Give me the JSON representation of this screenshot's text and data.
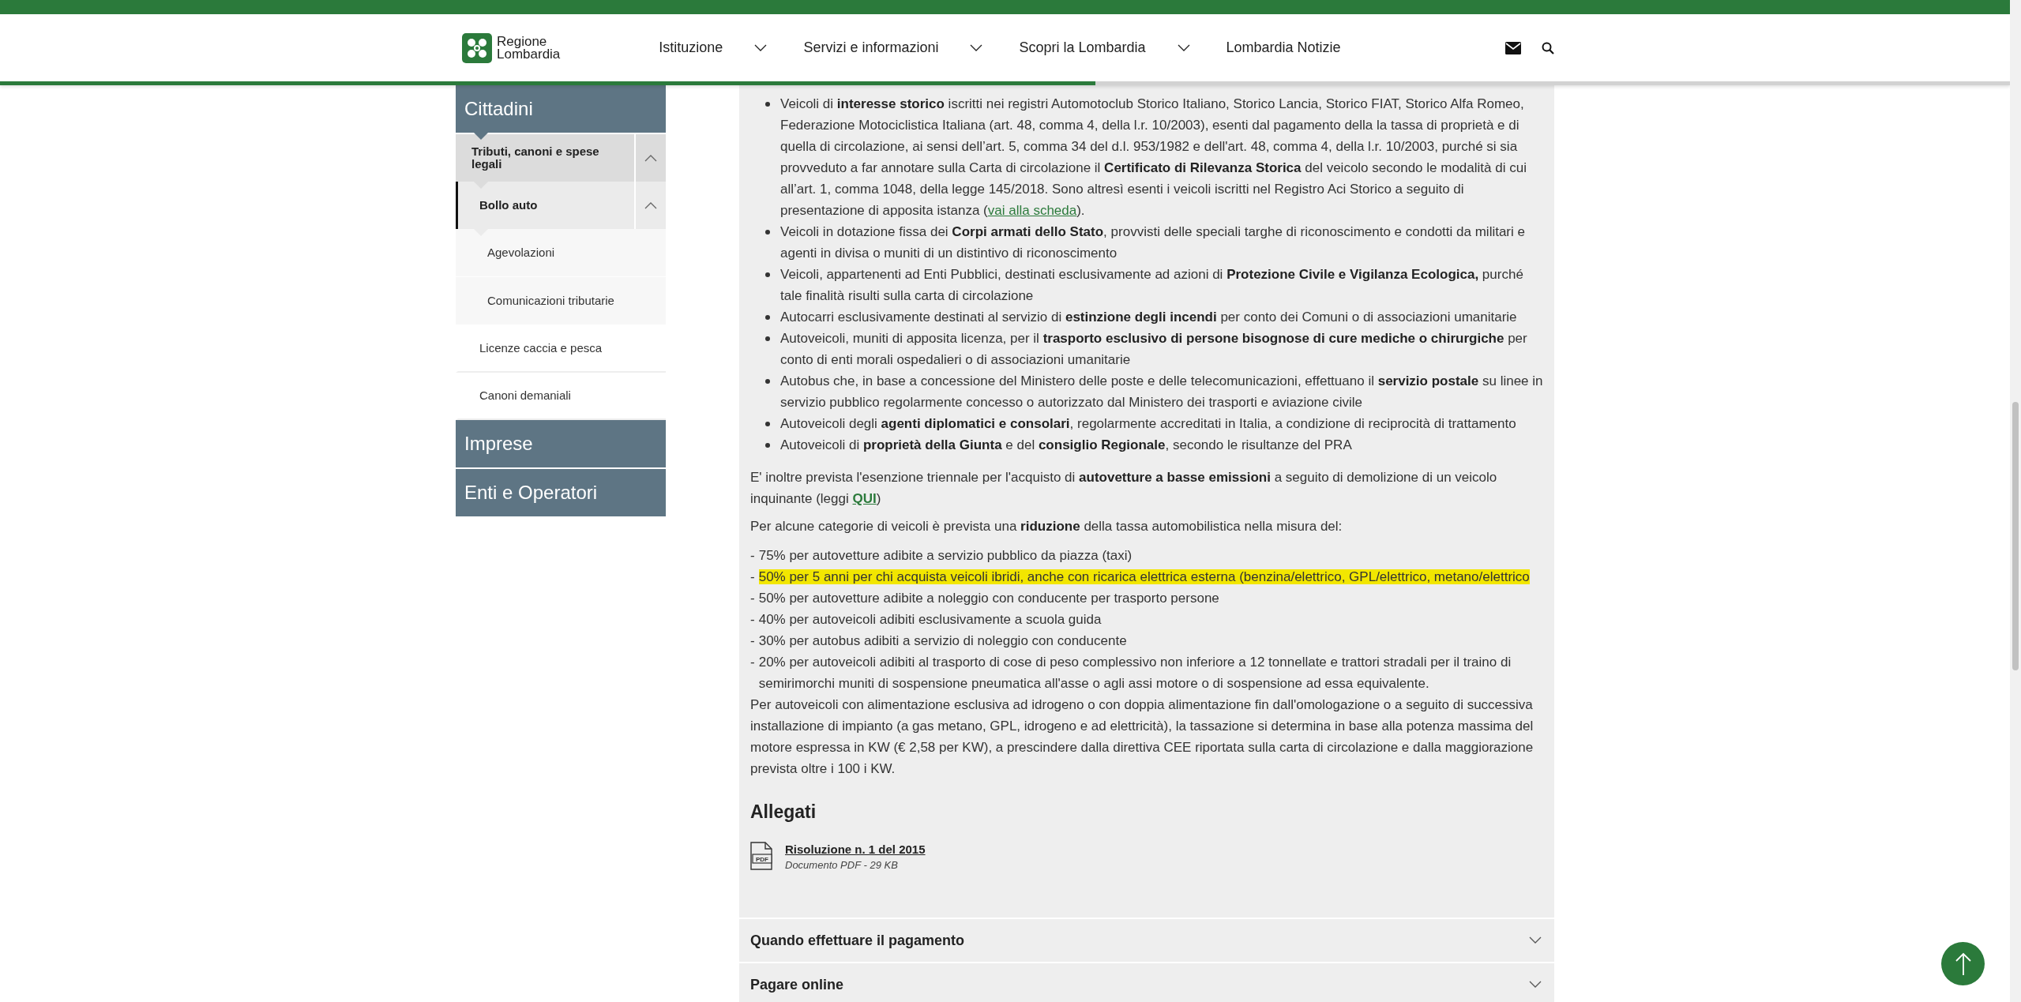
{
  "header": {
    "logo_lines": [
      "Regione",
      "Lombardia"
    ],
    "nav": [
      {
        "label": "Istituzione",
        "has_dropdown": true
      },
      {
        "label": "Servizi e informazioni",
        "has_dropdown": true
      },
      {
        "label": "Scopri la Lombardia",
        "has_dropdown": true
      },
      {
        "label": "Lombardia Notizie",
        "has_dropdown": false
      }
    ]
  },
  "reading_progress": {
    "level": 0.545
  },
  "sidebar": {
    "sections": [
      {
        "label": "Cittadini",
        "expanded": true,
        "children": [
          {
            "label": "Tributi, canoni e spese legali",
            "kind": "folder",
            "expanded": true,
            "selected": false,
            "children": [
              {
                "label": "Bollo auto",
                "kind": "folder",
                "expanded": true,
                "selected": true,
                "children": [
                  {
                    "label": "Agevolazioni",
                    "kind": "link",
                    "selected": false
                  },
                  {
                    "label": "Comunicazioni tributarie",
                    "kind": "link",
                    "selected": false
                  }
                ]
              }
            ]
          },
          {
            "label": "Licenze caccia e pesca",
            "kind": "link",
            "selected": false
          },
          {
            "label": "Canoni demaniali",
            "kind": "link",
            "selected": false
          }
        ]
      },
      {
        "label": "Imprese",
        "expanded": false
      },
      {
        "label": "Enti e Operatori",
        "expanded": false
      }
    ]
  },
  "article": {
    "exemptions": [
      {
        "text": "Veicoli di **interesse storico** iscritti nei registri Automotoclub Storico Italiano, Storico Lancia, Storico FIAT, Storico Alfa Romeo, Federazione Motociclistica Italiana (art. 48, comma 4, della l.r. 10/2003), esenti dal pagamento della la tassa di proprietà e di quella di circolazione, ai sensi dell’art. 5, comma 34 del d.l. 953/1982 e dell'art. 48, comma 4, della l.r. 10/2003, purché si sia provveduto a far annotare sulla Carta di circolazione il **Certificato di Rilevanza Storica** del veicolo secondo le modalità di cui all’art. 1, comma 1048, della legge 145/2018. Sono altresì esenti i veicoli iscritti nel Registro Aci Storico a seguito di presentazione di apposita istanza (",
        "link": "vai alla scheda",
        "tail": ")."
      },
      {
        "text": "Veicoli in dotazione fissa dei **Corpi armati dello Stato**, provvisti delle speciali targhe di riconoscimento e condotti da militari e agenti in divisa o muniti di un distintivo di riconoscimento"
      },
      {
        "text": "Veicoli, appartenenti ad Enti Pubblici, destinati esclusivamente ad azioni di **Protezione Civile e Vigilanza Ecologica,** purché tale finalità risulti sulla carta di circolazione"
      },
      {
        "text": "Autocarri esclusivamente destinati al servizio di **estinzione degli incendi** per conto dei Comuni o di associazioni umanitarie"
      },
      {
        "text": "Autoveicoli, muniti di apposita licenza, per il **trasporto esclusivo di persone bisognose di cure mediche o chirurgiche** per conto di enti morali ospedalieri o di associazioni umanitarie"
      },
      {
        "text": "Autobus che, in base a concessione del Ministero delle poste e delle telecomunicazioni, effettuano il **servizio postale** su linee in servizio pubblico regolarmente concesso o autorizzato dal Ministero dei trasporti e aviazione civile"
      },
      {
        "text": "Autoveicoli degli **agenti diplomatici e consolari**, regolarmente accreditati in Italia, a condizione di reciprocità di trattamento"
      },
      {
        "text": "Autoveicoli di **proprietà della Giunta** e del **consiglio Regionale**, secondo le risultanze del PRA"
      }
    ],
    "low_emission_note": {
      "text": "E' inoltre prevista l'esenzione triennale per l'acquisto di **autovetture a basse emissioni** a seguito di demolizione di un veicolo inquinante (leggi ",
      "link": "QUI",
      "tail": ")"
    },
    "reduction_intro": "Per alcune categorie di veicoli è prevista una **riduzione** della tassa automobilistica nella misura del:",
    "reductions": [
      {
        "marker": "-",
        "text": "75% per autovetture adibite a servizio pubblico da piazza (taxi)",
        "highlighted": false
      },
      {
        "marker": "-",
        "text": "50% per 5 anni per chi acquista veicoli ibridi, anche con ricarica elettrica esterna (benzina/elettrico, GPL/elettrico, metano/elettrico",
        "highlighted": true
      },
      {
        "marker": "-",
        "text": "50% per autovetture adibite a noleggio con conducente per trasporto persone",
        "highlighted": false
      },
      {
        "marker": "-",
        "text": "40% per autoveicoli adibiti esclusivamente a scuola guida",
        "highlighted": false
      },
      {
        "marker": "-",
        "text": "30% per autobus adibiti a servizio di noleggio con conducente",
        "highlighted": false
      },
      {
        "marker": "-",
        "text": "20% per autoveicoli adibiti al trasporto di cose di peso complessivo non inferiore a 12 tonnellate e trattori stradali per il traino di semirimorchi muniti di sospensione pneumatica all'asse o agli assi motore o di sospensione ad essa equivalente.",
        "highlighted": false
      }
    ],
    "hydrogen_note": "Per autoveicoli con alimentazione esclusiva ad idrogeno o con doppia alimentazione fin dall'omologazione o a seguito di successiva installazione di impianto (a gas metano, GPL, idrogeno e ad elettricità), la tassazione si determina in base alla potenza massima del motore espressa in KW (€ 2,58 per KW), a prescindere dalla direttiva CEE riportata sulla carta di circolazione e dalla maggiorazione prevista oltre i 100 i KW.",
    "attachments": {
      "title": "Allegati",
      "items": [
        {
          "icon_label": "PDF",
          "title": "Risoluzione n. 1 del 2015",
          "meta": "Documento PDF - 29 KB"
        }
      ]
    }
  },
  "accordions": [
    {
      "title": "Quando effettuare il pagamento",
      "expanded": false
    },
    {
      "title": "Pagare online",
      "expanded": false
    }
  ]
}
